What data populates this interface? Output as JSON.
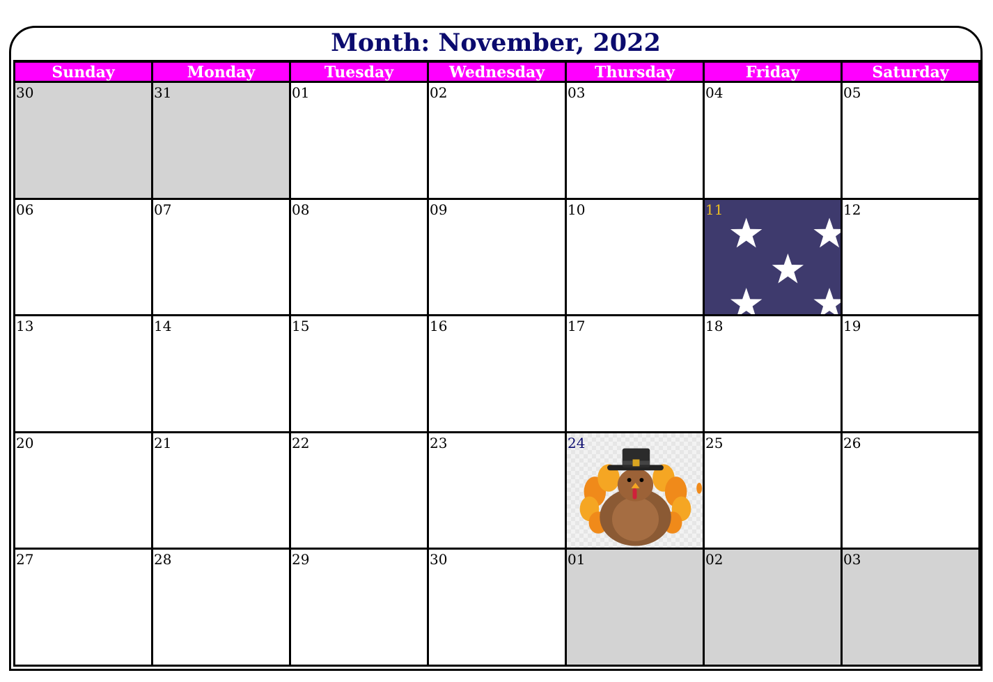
{
  "calendar": {
    "title": "Month: November, 2022",
    "weekdays": [
      "Sunday",
      "Monday",
      "Tuesday",
      "Wednesday",
      "Thursday",
      "Friday",
      "Saturday"
    ],
    "weeks": [
      [
        {
          "day": "30",
          "in_month": false
        },
        {
          "day": "31",
          "in_month": false
        },
        {
          "day": "01",
          "in_month": true
        },
        {
          "day": "02",
          "in_month": true
        },
        {
          "day": "03",
          "in_month": true
        },
        {
          "day": "04",
          "in_month": true
        },
        {
          "day": "05",
          "in_month": true
        }
      ],
      [
        {
          "day": "06",
          "in_month": true
        },
        {
          "day": "07",
          "in_month": true
        },
        {
          "day": "08",
          "in_month": true
        },
        {
          "day": "09",
          "in_month": true
        },
        {
          "day": "10",
          "in_month": true
        },
        {
          "day": "11",
          "in_month": true,
          "decoration": "stars-pattern"
        },
        {
          "day": "12",
          "in_month": true
        }
      ],
      [
        {
          "day": "13",
          "in_month": true
        },
        {
          "day": "14",
          "in_month": true
        },
        {
          "day": "15",
          "in_month": true
        },
        {
          "day": "16",
          "in_month": true
        },
        {
          "day": "17",
          "in_month": true
        },
        {
          "day": "18",
          "in_month": true
        },
        {
          "day": "19",
          "in_month": true
        }
      ],
      [
        {
          "day": "20",
          "in_month": true
        },
        {
          "day": "21",
          "in_month": true
        },
        {
          "day": "22",
          "in_month": true
        },
        {
          "day": "23",
          "in_month": true
        },
        {
          "day": "24",
          "in_month": true,
          "decoration": "turkey-image"
        },
        {
          "day": "25",
          "in_month": true
        },
        {
          "day": "26",
          "in_month": true
        }
      ],
      [
        {
          "day": "27",
          "in_month": true
        },
        {
          "day": "28",
          "in_month": true
        },
        {
          "day": "29",
          "in_month": true
        },
        {
          "day": "30",
          "in_month": true
        },
        {
          "day": "01",
          "in_month": false
        },
        {
          "day": "02",
          "in_month": false
        },
        {
          "day": "03",
          "in_month": false
        }
      ]
    ]
  },
  "colors": {
    "title": "#0b0b6e",
    "weekday_header_bg": "#ff00ff",
    "weekday_header_text": "#ffffff",
    "outside_month_bg": "#d3d3d3",
    "stars_bg": "#3e3a6d",
    "stars_day_number": "#f0c020"
  }
}
